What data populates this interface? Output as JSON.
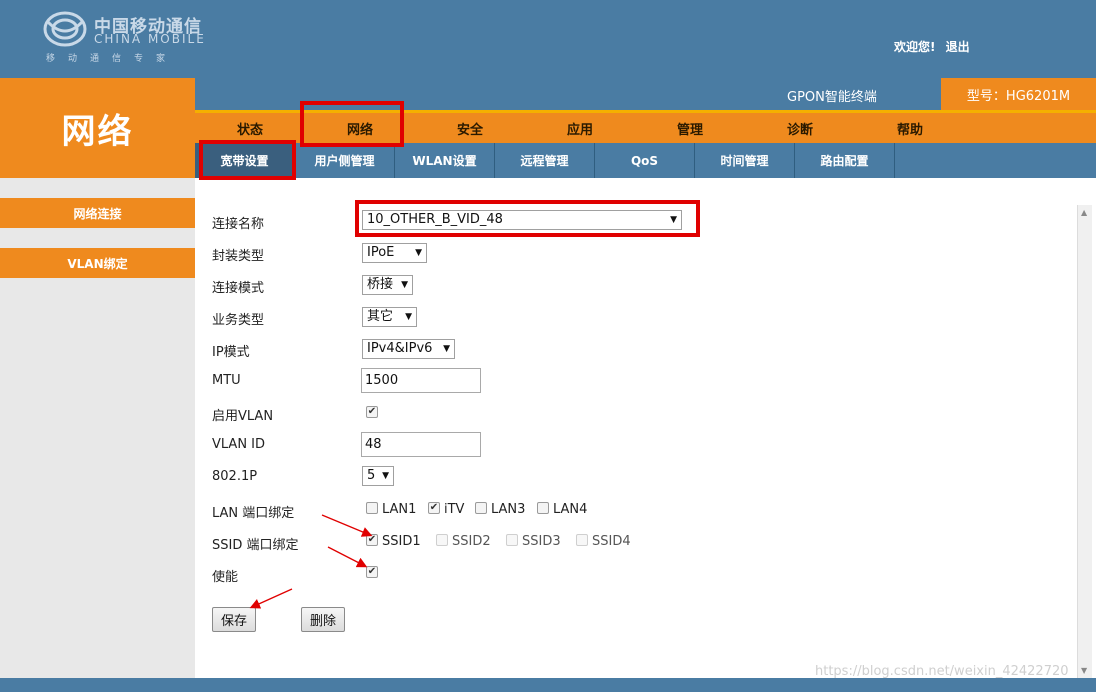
{
  "header": {
    "logo_cn": "中国移动通信",
    "logo_en": "CHINA MOBILE",
    "logo_sub": "移动通信专家",
    "welcome": "欢迎您!",
    "logout": "退出"
  },
  "section_title": "网络",
  "device": {
    "name": "GPON智能终端",
    "model": "型号：HG6201M"
  },
  "main_menu": [
    "状态",
    "网络",
    "安全",
    "应用",
    "管理",
    "诊断",
    "帮助"
  ],
  "sub_menu": [
    "宽带设置",
    "用户侧管理",
    "WLAN设置",
    "远程管理",
    "QoS",
    "时间管理",
    "路由配置"
  ],
  "sidebar": [
    "网络连接",
    "VLAN绑定"
  ],
  "form": {
    "conn_name_label": "连接名称",
    "conn_name_value": "10_OTHER_B_VID_48",
    "encap_label": "封装类型",
    "encap_value": "IPoE",
    "mode_label": "连接模式",
    "mode_value": "桥接",
    "service_label": "业务类型",
    "service_value": "其它",
    "ipmode_label": "IP模式",
    "ipmode_value": "IPv4&IPv6",
    "mtu_label": "MTU",
    "mtu_value": "1500",
    "vlan_enable_label": "启用VLAN",
    "vlan_id_label": "VLAN ID",
    "vlan_id_value": "48",
    "dot1p_label": "802.1P",
    "dot1p_value": "5",
    "lan_bind_label": "LAN 端口绑定",
    "lan_ports": [
      "LAN1",
      "iTV",
      "LAN3",
      "LAN4"
    ],
    "ssid_bind_label": "SSID 端口绑定",
    "ssid_ports": [
      "SSID1",
      "SSID2",
      "SSID3",
      "SSID4"
    ],
    "enable_label": "使能",
    "save_label": "保存",
    "delete_label": "删除"
  },
  "checkbox_states": {
    "vlan_enable": true,
    "lan": [
      false,
      true,
      false,
      false
    ],
    "ssid": [
      true,
      false,
      false,
      false
    ],
    "enable": true
  },
  "watermark": "https://blog.csdn.net/weixin_42422720",
  "colors": {
    "blue": "#4a7ca3",
    "orange": "#ef8a1e",
    "annotation_red": "#e00000"
  }
}
